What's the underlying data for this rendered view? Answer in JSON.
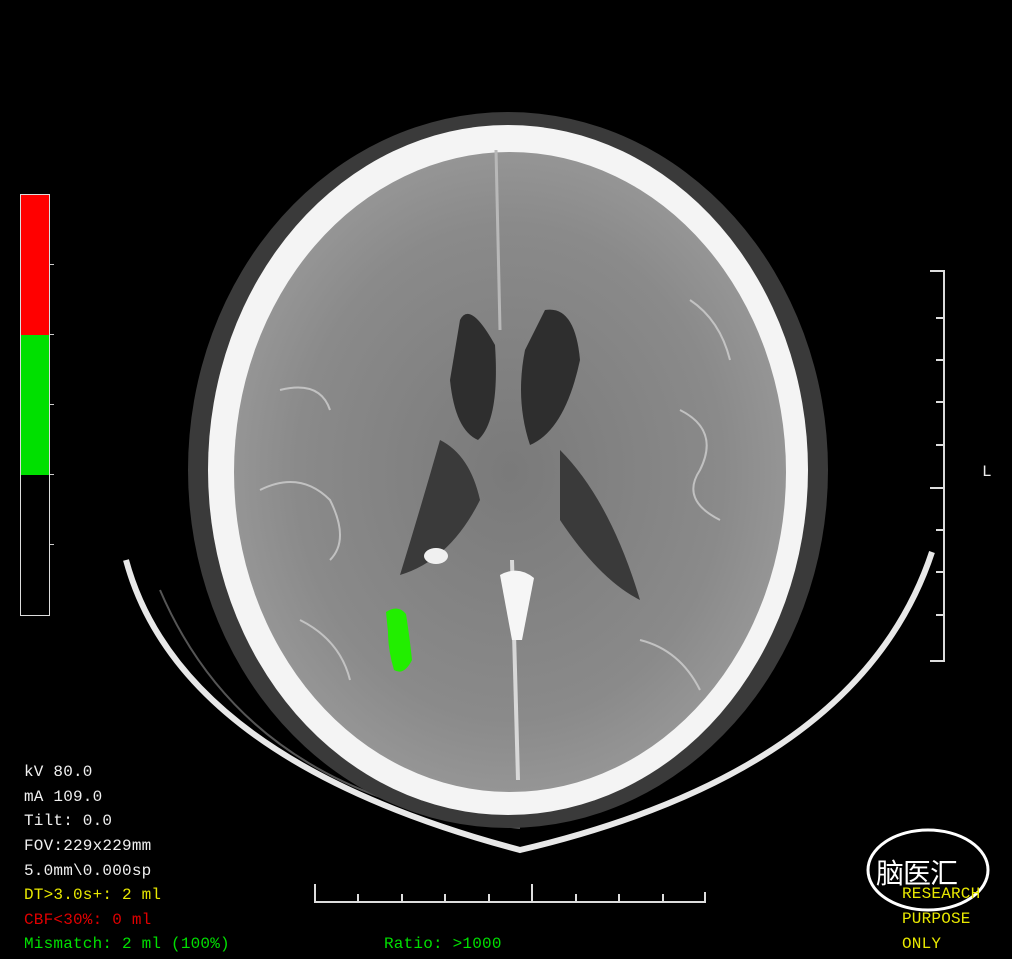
{
  "overlay": {
    "orientation_label": "L",
    "scan_params": [
      "kV 80.0",
      "mA 109.0",
      "Tilt: 0.0",
      "FOV:229x229mm",
      "5.0mm\\0.000sp"
    ],
    "dt_threshold": "DT>3.0s+: 2 ml",
    "cbf_threshold": "CBF<30%: 0 ml",
    "mismatch": "Mismatch: 2 ml (100%)",
    "ratio": "Ratio: >1000",
    "research_notice": [
      "RESEARCH",
      "PURPOSE",
      "ONLY"
    ],
    "watermark_text": "脑医汇"
  },
  "colors": {
    "background": "#000000",
    "colorbar_red": "#ff0000",
    "colorbar_green": "#00e000",
    "lesion_green": "#22ee00",
    "dt_text": "#e8e800",
    "cbf_text": "#e00000",
    "mismatch_text": "#00e000",
    "research_text": "#e8e800"
  },
  "icons": {
    "colorbar": "color-scale-bar",
    "ruler": "scale-ruler",
    "watermark": "brand-logo"
  }
}
